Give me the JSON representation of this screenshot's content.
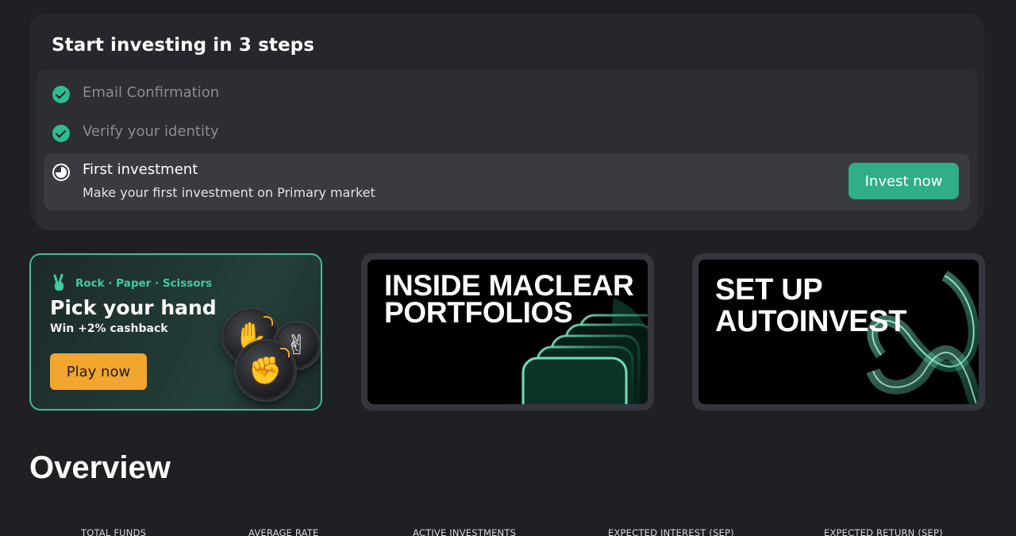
{
  "steps": {
    "title": "Start investing in 3 steps",
    "items": [
      {
        "label": "Email Confirmation",
        "status": "done"
      },
      {
        "label": "Verify your identity",
        "status": "done"
      },
      {
        "label": "First investment",
        "status": "in-progress",
        "description": "Make your first investment on Primary market",
        "button": "Invest now"
      }
    ]
  },
  "promos": {
    "rps": {
      "badge": "Rock · Paper · Scissors",
      "title": "Pick your hand",
      "subtitle": "Win +2% cashback",
      "button": "Play now",
      "icon": "peace-hand-icon"
    },
    "maclear": {
      "title_line1": "INSIDE MACLEAR",
      "title_line2": "PORTFOLIOS"
    },
    "autoinvest": {
      "title_line1": "SET UP",
      "title_line2": "AUTOINVEST"
    }
  },
  "overview": {
    "title": "Overview",
    "stats": [
      {
        "label": "TOTAL FUNDS"
      },
      {
        "label": "AVERAGE RATE"
      },
      {
        "label": "ACTIVE INVESTMENTS"
      },
      {
        "label": "EXPECTED INTEREST (SEP)"
      },
      {
        "label": "EXPECTED RETURN (SEP)"
      }
    ]
  },
  "colors": {
    "background": "#1f2024",
    "accent_green": "#2fae87",
    "accent_orange": "#f3a62d"
  }
}
